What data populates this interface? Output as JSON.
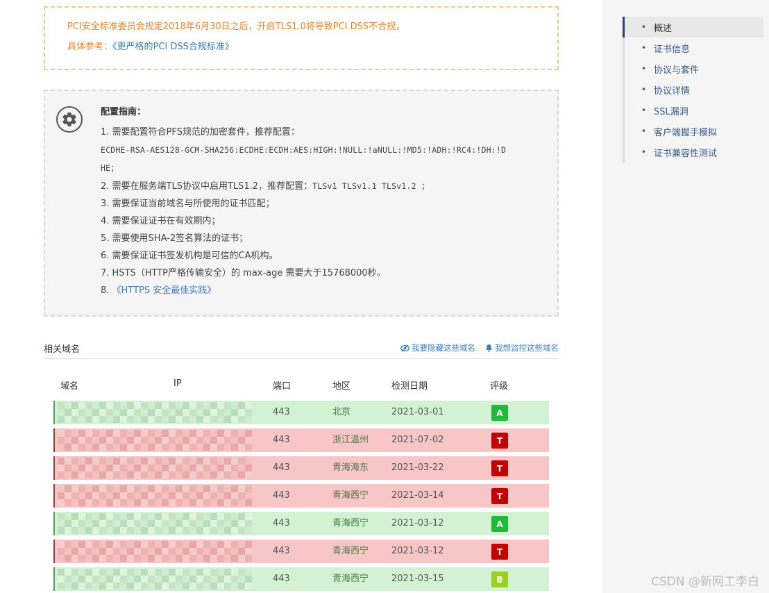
{
  "warning": {
    "line1": "PCI安全标准委员会规定2018年6月30日之后，开启TLS1.0将导致PCI DSS不合规，",
    "ref_prefix": "具体参考：",
    "ref_link": "《更严格的PCI DSS合规标准》"
  },
  "guide": {
    "title": "配置指南：",
    "item1": "1. 需要配置符合PFS规范的加密套件，推荐配置：",
    "cipher_line1": "ECDHE-RSA-AES128-GCM-SHA256:ECDHE:ECDH:AES:HIGH:!NULL:!aNULL:!MD5:!ADH:!RC4:!DH:!D",
    "cipher_line2": "HE；",
    "item2_text": "2. 需要在服务端TLS协议中启用TLS1.2，推荐配置：",
    "item2_code": "TLSv1 TLSv1.1 TLSv1.2 ；",
    "item3": "3. 需要保证当前域名与所使用的证书匹配；",
    "item4": "4. 需要保证证书在有效期内；",
    "item5": "5. 需要使用SHA-2签名算法的证书；",
    "item6": "6. 需要保证证书签发机构是可信的CA机构。",
    "item7": "7. HSTS（HTTP严格传输安全）的 max-age 需要大于15768000秒。",
    "item8_prefix": "8. ",
    "item8_link": "《HTTPS 安全最佳实践》"
  },
  "related": {
    "title": "相关域名",
    "hide_action": "我要隐藏这些域名",
    "monitor_action": "我想监控这些域名"
  },
  "table": {
    "headers": {
      "domain": "域名",
      "ip": "IP",
      "port": "端口",
      "region": "地区",
      "date": "检测日期",
      "grade": "评级"
    },
    "rows": [
      {
        "status": "green",
        "port": "443",
        "region": "北京",
        "date": "2021-03-01",
        "grade": "A",
        "grade_color": "#1fba37"
      },
      {
        "status": "red",
        "port": "443",
        "region": "浙江温州",
        "date": "2021-07-02",
        "grade": "T",
        "grade_color": "#c40000"
      },
      {
        "status": "red",
        "port": "443",
        "region": "青海海东",
        "date": "2021-03-22",
        "grade": "T",
        "grade_color": "#c40000"
      },
      {
        "status": "red",
        "port": "443",
        "region": "青海西宁",
        "date": "2021-03-14",
        "grade": "T",
        "grade_color": "#c40000"
      },
      {
        "status": "green",
        "port": "443",
        "region": "青海西宁",
        "date": "2021-03-12",
        "grade": "A",
        "grade_color": "#1fba37"
      },
      {
        "status": "red",
        "port": "443",
        "region": "青海西宁",
        "date": "2021-03-12",
        "grade": "T",
        "grade_color": "#c40000"
      },
      {
        "status": "green",
        "port": "443",
        "region": "青海西宁",
        "date": "2021-03-15",
        "grade": "B",
        "grade_color": "#9ad020"
      }
    ]
  },
  "nav": {
    "items": [
      "概述",
      "证书信息",
      "协议与套件",
      "协议详情",
      "SSL漏洞",
      "客户端握手模拟",
      "证书兼容性测试"
    ],
    "active_index": 0
  },
  "watermark": "CSDN @新网工李白"
}
